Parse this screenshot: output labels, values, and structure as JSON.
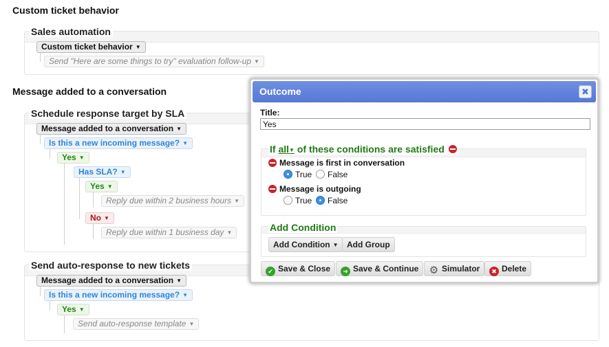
{
  "sections": [
    {
      "title": "Custom ticket behavior",
      "groups": [
        {
          "title": "Sales automation",
          "trigger": "Custom ticket behavior",
          "action": "Send \"Here are some things to try\" evaluation follow-up"
        }
      ]
    },
    {
      "title": "Message added to a conversation",
      "groups": [
        {
          "title": "Schedule response target by SLA",
          "trigger": "Message added to a conversation",
          "condition": "Is this a new incoming message?",
          "yes_label": "Yes",
          "sub_condition": "Has SLA?",
          "sub_yes_label": "Yes",
          "sub_yes_action": "Reply due within 2 business hours",
          "sub_no_label": "No",
          "sub_no_action": "Reply due within 1 business day"
        },
        {
          "title": "Send auto-response to new tickets",
          "trigger": "Message added to a conversation",
          "condition": "Is this a new incoming message?",
          "yes_label": "Yes",
          "action": "Send auto-response template"
        }
      ]
    }
  ],
  "dialog": {
    "title": "Outcome",
    "close_symbol": "✖",
    "title_label": "Title:",
    "title_value": "Yes",
    "conditions_prefix": "If",
    "conditions_mode": "all",
    "conditions_suffix": "of these conditions are satisfied",
    "conditions": [
      {
        "label": "Message is first in conversation",
        "options": [
          "True",
          "False"
        ],
        "selected": "True"
      },
      {
        "label": "Message is outgoing",
        "options": [
          "True",
          "False"
        ],
        "selected": "False"
      }
    ],
    "add_condition_title": "Add Condition",
    "add_condition_button": "Add Condition",
    "add_group_button": "Add Group",
    "buttons": {
      "save_close": "Save & Close",
      "save_continue": "Save & Continue",
      "simulator": "Simulator",
      "delete": "Delete"
    }
  },
  "colors": {
    "dialog_header": "#5678d6",
    "condition_green": "#1f8a12",
    "condition_blue": "#2e86d6",
    "no_red": "#b01515",
    "delete_red": "#c9242b"
  }
}
